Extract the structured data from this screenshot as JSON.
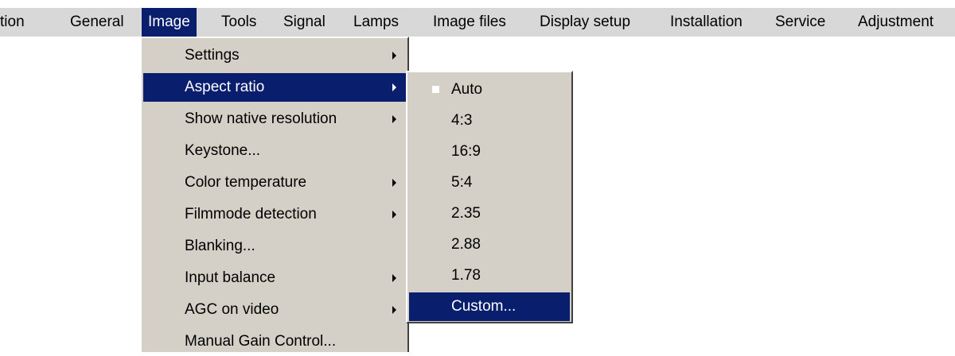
{
  "menubar": {
    "items": [
      {
        "label": "tion",
        "active": false
      },
      {
        "label": "General",
        "active": false
      },
      {
        "label": "Image",
        "active": true
      },
      {
        "label": "Tools",
        "active": false
      },
      {
        "label": "Signal",
        "active": false
      },
      {
        "label": "Lamps",
        "active": false
      },
      {
        "label": "Image files",
        "active": false
      },
      {
        "label": "Display setup",
        "active": false
      },
      {
        "label": "Installation",
        "active": false
      },
      {
        "label": "Service",
        "active": false
      },
      {
        "label": "Adjustment",
        "active": false
      }
    ]
  },
  "image_menu": {
    "items": [
      {
        "label": "Settings",
        "submenu": true
      },
      {
        "label": "Aspect ratio",
        "submenu": true,
        "selected": true
      },
      {
        "label": "Show native resolution",
        "submenu": true
      },
      {
        "label": "Keystone...",
        "submenu": false
      },
      {
        "label": "Color temperature",
        "submenu": true
      },
      {
        "label": "Filmmode detection",
        "submenu": true
      },
      {
        "label": "Blanking...",
        "submenu": false
      },
      {
        "label": "Input balance",
        "submenu": true
      },
      {
        "label": "AGC on video",
        "submenu": true
      },
      {
        "label": "Manual Gain Control...",
        "submenu": false
      }
    ]
  },
  "aspect_menu": {
    "items": [
      {
        "label": "Auto",
        "checked": true
      },
      {
        "label": "4:3"
      },
      {
        "label": "16:9"
      },
      {
        "label": "5:4"
      },
      {
        "label": "2.35"
      },
      {
        "label": "2.88"
      },
      {
        "label": "1.78"
      },
      {
        "label": "Custom...",
        "selected": true
      }
    ]
  },
  "colors": {
    "highlight": "#0a1e6e",
    "menu_bg": "#d4d0c8",
    "menubar_bg": "#d8d8d8"
  }
}
